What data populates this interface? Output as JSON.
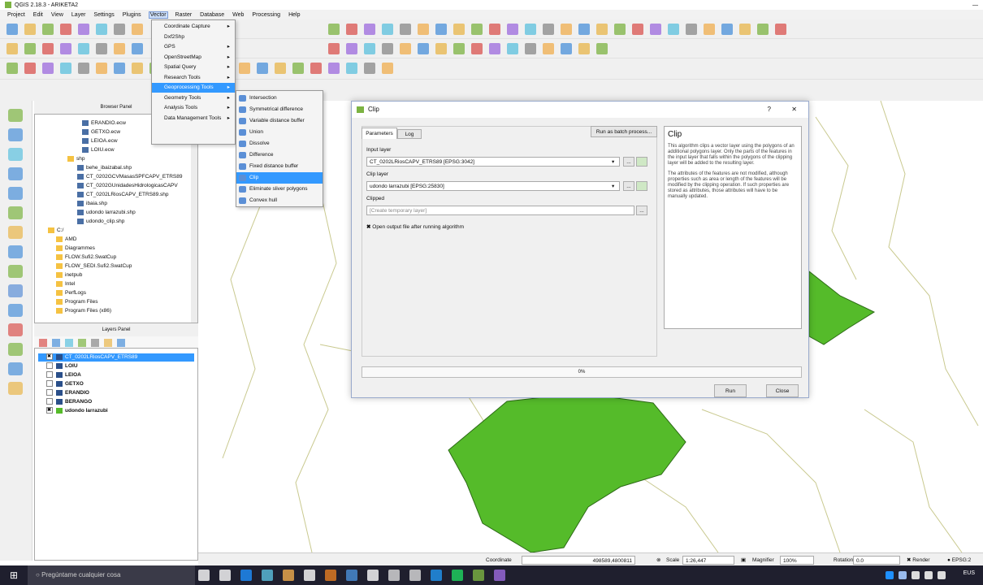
{
  "window": {
    "title": "QGIS 2.18.3 - ARIKETA2"
  },
  "menubar": [
    "Project",
    "Edit",
    "View",
    "Layer",
    "Settings",
    "Plugins",
    "Vector",
    "Raster",
    "Database",
    "Web",
    "Processing",
    "Help"
  ],
  "vector_menu": [
    "Coordinate Capture",
    "Dxf2Shp",
    "GPS",
    "OpenStreetMap",
    "Spatial Query",
    "Research Tools",
    "Geoprocessing Tools",
    "Geometry Tools",
    "Analysis Tools",
    "Data Management Tools"
  ],
  "geo_submenu": [
    "Intersection",
    "Symmetrical difference",
    "Variable distance buffer",
    "Union",
    "Dissolve",
    "Difference",
    "Fixed distance buffer",
    "Clip",
    "Eliminate sliver polygons",
    "Convex hull"
  ],
  "browser": {
    "title": "Browser Panel",
    "items": [
      "ERANDIO.ecw",
      "GETXO.ecw",
      "LEIOA.ecw",
      "LOIU.ecw",
      "shp",
      "behe_ibaizabal.shp",
      "CT_0202GCVMasasSPFCAPV_ETRS89",
      "CT_0202GUnidadesHidrologicasCAPV",
      "CT_0202LRiosCAPV_ETRS89.shp",
      "ibaia.shp",
      "udondo larrazubi.shp",
      "udondo_clip.shp",
      "C:/",
      "AMD",
      "Diagrammes",
      "FLOW.Sufi2.SwatCup",
      "FLOW_SEDI.Sufi2.SwatCup",
      "inetpub",
      "Intel",
      "PerfLogs",
      "Program Files",
      "Program Files (x86)"
    ]
  },
  "layers": {
    "title": "Layers Panel",
    "items": [
      "CT_0202LRiosCAPV_ETRS89",
      "LOIU",
      "LEIOA",
      "GETXO",
      "ERANDIO",
      "BERANGO",
      "udondo larrazubi"
    ]
  },
  "dialog": {
    "title": "Clip",
    "help_mark": "?",
    "close_mark": "✕",
    "tab_params": "Parameters",
    "tab_log": "Log",
    "batch": "Run as batch process...",
    "input_label": "Input layer",
    "input_value": "CT_0202LRiosCAPV_ETRS89 [EPSG:3042]",
    "clip_label": "Clip layer",
    "clip_value": "udondo larrazubi [EPSG:25830]",
    "clipped_label": "Clipped",
    "clipped_placeholder": "[Create temporary layer]",
    "dots": "...",
    "open_output": "Open output file after running algorithm",
    "progress": "0%",
    "run": "Run",
    "close": "Close",
    "help_title": "Clip",
    "help_p1": "This algorithm clips a vector layer using the polygons of an additional polygons layer. Only the parts of the features in the input layer that falls within the polygons of the clipping layer will be added to the resulting layer.",
    "help_p2": "The attributes of the features are not modified, although properties such as area or length of the features will be modified by the clipping operation. If such properties are stored as attributes, those attributes will have to be manually updated."
  },
  "status": {
    "coordinate_label": "Coordinate",
    "coordinate": "498589,4800811",
    "scale_label": "Scale",
    "scale": "1:26,447",
    "magnifier_label": "Magnifier",
    "magnifier": "100%",
    "rotation_label": "Rotation",
    "rotation": "0.0",
    "render": "Render",
    "epsg": "EPSG:2"
  },
  "taskbar": {
    "search": "Pregúntame cualquier cosa",
    "lang": "EUS"
  }
}
